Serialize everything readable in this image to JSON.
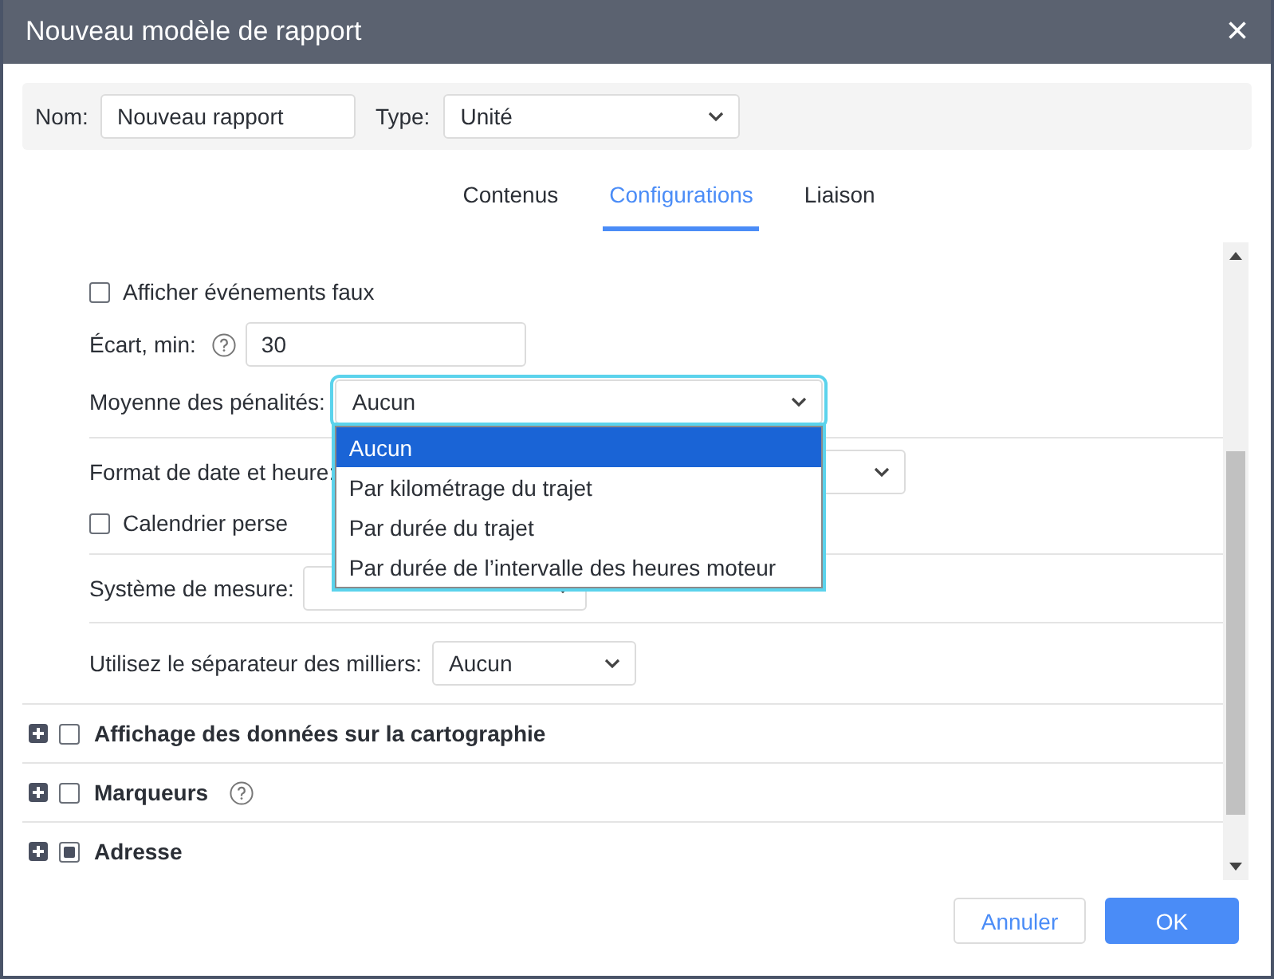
{
  "window": {
    "title": "Nouveau modèle de rapport",
    "close": "×"
  },
  "header": {
    "name_label": "Nom:",
    "name_value": "Nouveau rapport",
    "type_label": "Type:",
    "type_value": "Unité"
  },
  "tabs": [
    {
      "label": "Contenus",
      "selected": false
    },
    {
      "label": "Configurations",
      "selected": true
    },
    {
      "label": "Liaison",
      "selected": false
    }
  ],
  "settings": [
    {
      "kind": "checkbox",
      "label": "Afficher événements faux",
      "checked": false
    },
    {
      "kind": "number",
      "label": "Écart, min:",
      "help": true,
      "value": "30"
    },
    {
      "kind": "select",
      "label": "Moyenne des pénalités:",
      "value": "Aucun",
      "open": true,
      "options": [
        {
          "label": "Aucun",
          "selected": true
        },
        {
          "label": "Par kilométrage du trajet",
          "selected": false
        },
        {
          "label": "Par durée du trajet",
          "selected": false
        },
        {
          "label": "Par durée de l’intervalle des heures moteur",
          "selected": false
        }
      ]
    },
    {
      "kind": "divider"
    },
    {
      "kind": "select",
      "label": "Format de date et heure:",
      "open": false
    },
    {
      "kind": "checkbox",
      "label": "Calendrier perse",
      "checked": false
    },
    {
      "kind": "divider"
    },
    {
      "kind": "select",
      "label": "Système de mesure:",
      "open": false
    },
    {
      "kind": "divider"
    },
    {
      "kind": "select",
      "label": "Utilisez le séparateur des milliers:",
      "value": "Aucun",
      "open": false
    }
  ],
  "sections": [
    {
      "label": "Affichage des données sur la cartographie",
      "checked": false,
      "indeterminate": false,
      "help": false
    },
    {
      "label": "Marqueurs",
      "checked": false,
      "indeterminate": false,
      "help": true
    },
    {
      "label": "Adresse",
      "checked": false,
      "indeterminate": true,
      "help": false
    }
  ],
  "buttons": [
    {
      "label": "Annuler",
      "kind": "secondary"
    },
    {
      "label": "OK",
      "kind": "primary"
    }
  ]
}
